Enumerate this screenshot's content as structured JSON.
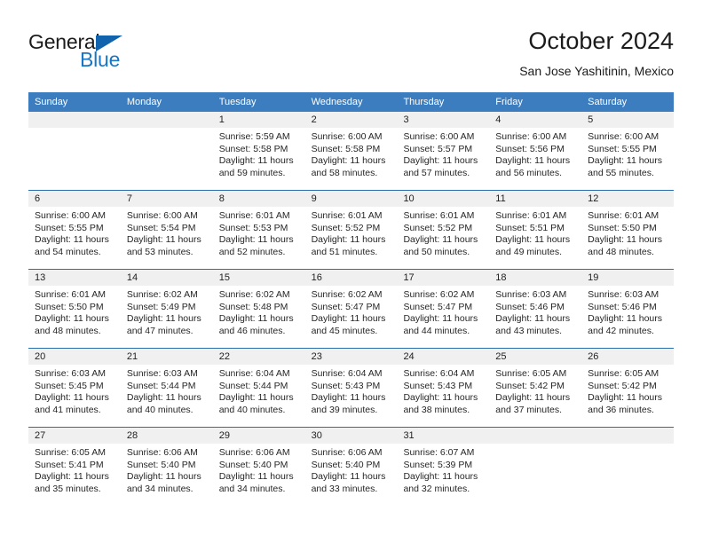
{
  "logo": {
    "word_top": "General",
    "word_bottom": "Blue",
    "triangle_icon": "triangle-icon",
    "brand_blue": "#1877c4",
    "brand_dark": "#1263ad"
  },
  "header": {
    "title": "October 2024",
    "location": "San Jose Yashitinin, Mexico"
  },
  "calendar": {
    "header_bg": "#3b7dbf",
    "daynum_bg": "#f0f0f0",
    "row_border": "#2f6ca8",
    "weekdays": [
      "Sunday",
      "Monday",
      "Tuesday",
      "Wednesday",
      "Thursday",
      "Friday",
      "Saturday"
    ],
    "weeks": [
      [
        {
          "day": "",
          "sunrise": "",
          "sunset": "",
          "daylight_1": "",
          "daylight_2": ""
        },
        {
          "day": "",
          "sunrise": "",
          "sunset": "",
          "daylight_1": "",
          "daylight_2": ""
        },
        {
          "day": "1",
          "sunrise": "Sunrise: 5:59 AM",
          "sunset": "Sunset: 5:58 PM",
          "daylight_1": "Daylight: 11 hours",
          "daylight_2": "and 59 minutes."
        },
        {
          "day": "2",
          "sunrise": "Sunrise: 6:00 AM",
          "sunset": "Sunset: 5:58 PM",
          "daylight_1": "Daylight: 11 hours",
          "daylight_2": "and 58 minutes."
        },
        {
          "day": "3",
          "sunrise": "Sunrise: 6:00 AM",
          "sunset": "Sunset: 5:57 PM",
          "daylight_1": "Daylight: 11 hours",
          "daylight_2": "and 57 minutes."
        },
        {
          "day": "4",
          "sunrise": "Sunrise: 6:00 AM",
          "sunset": "Sunset: 5:56 PM",
          "daylight_1": "Daylight: 11 hours",
          "daylight_2": "and 56 minutes."
        },
        {
          "day": "5",
          "sunrise": "Sunrise: 6:00 AM",
          "sunset": "Sunset: 5:55 PM",
          "daylight_1": "Daylight: 11 hours",
          "daylight_2": "and 55 minutes."
        }
      ],
      [
        {
          "day": "6",
          "sunrise": "Sunrise: 6:00 AM",
          "sunset": "Sunset: 5:55 PM",
          "daylight_1": "Daylight: 11 hours",
          "daylight_2": "and 54 minutes."
        },
        {
          "day": "7",
          "sunrise": "Sunrise: 6:00 AM",
          "sunset": "Sunset: 5:54 PM",
          "daylight_1": "Daylight: 11 hours",
          "daylight_2": "and 53 minutes."
        },
        {
          "day": "8",
          "sunrise": "Sunrise: 6:01 AM",
          "sunset": "Sunset: 5:53 PM",
          "daylight_1": "Daylight: 11 hours",
          "daylight_2": "and 52 minutes."
        },
        {
          "day": "9",
          "sunrise": "Sunrise: 6:01 AM",
          "sunset": "Sunset: 5:52 PM",
          "daylight_1": "Daylight: 11 hours",
          "daylight_2": "and 51 minutes."
        },
        {
          "day": "10",
          "sunrise": "Sunrise: 6:01 AM",
          "sunset": "Sunset: 5:52 PM",
          "daylight_1": "Daylight: 11 hours",
          "daylight_2": "and 50 minutes."
        },
        {
          "day": "11",
          "sunrise": "Sunrise: 6:01 AM",
          "sunset": "Sunset: 5:51 PM",
          "daylight_1": "Daylight: 11 hours",
          "daylight_2": "and 49 minutes."
        },
        {
          "day": "12",
          "sunrise": "Sunrise: 6:01 AM",
          "sunset": "Sunset: 5:50 PM",
          "daylight_1": "Daylight: 11 hours",
          "daylight_2": "and 48 minutes."
        }
      ],
      [
        {
          "day": "13",
          "sunrise": "Sunrise: 6:01 AM",
          "sunset": "Sunset: 5:50 PM",
          "daylight_1": "Daylight: 11 hours",
          "daylight_2": "and 48 minutes."
        },
        {
          "day": "14",
          "sunrise": "Sunrise: 6:02 AM",
          "sunset": "Sunset: 5:49 PM",
          "daylight_1": "Daylight: 11 hours",
          "daylight_2": "and 47 minutes."
        },
        {
          "day": "15",
          "sunrise": "Sunrise: 6:02 AM",
          "sunset": "Sunset: 5:48 PM",
          "daylight_1": "Daylight: 11 hours",
          "daylight_2": "and 46 minutes."
        },
        {
          "day": "16",
          "sunrise": "Sunrise: 6:02 AM",
          "sunset": "Sunset: 5:47 PM",
          "daylight_1": "Daylight: 11 hours",
          "daylight_2": "and 45 minutes."
        },
        {
          "day": "17",
          "sunrise": "Sunrise: 6:02 AM",
          "sunset": "Sunset: 5:47 PM",
          "daylight_1": "Daylight: 11 hours",
          "daylight_2": "and 44 minutes."
        },
        {
          "day": "18",
          "sunrise": "Sunrise: 6:03 AM",
          "sunset": "Sunset: 5:46 PM",
          "daylight_1": "Daylight: 11 hours",
          "daylight_2": "and 43 minutes."
        },
        {
          "day": "19",
          "sunrise": "Sunrise: 6:03 AM",
          "sunset": "Sunset: 5:46 PM",
          "daylight_1": "Daylight: 11 hours",
          "daylight_2": "and 42 minutes."
        }
      ],
      [
        {
          "day": "20",
          "sunrise": "Sunrise: 6:03 AM",
          "sunset": "Sunset: 5:45 PM",
          "daylight_1": "Daylight: 11 hours",
          "daylight_2": "and 41 minutes."
        },
        {
          "day": "21",
          "sunrise": "Sunrise: 6:03 AM",
          "sunset": "Sunset: 5:44 PM",
          "daylight_1": "Daylight: 11 hours",
          "daylight_2": "and 40 minutes."
        },
        {
          "day": "22",
          "sunrise": "Sunrise: 6:04 AM",
          "sunset": "Sunset: 5:44 PM",
          "daylight_1": "Daylight: 11 hours",
          "daylight_2": "and 40 minutes."
        },
        {
          "day": "23",
          "sunrise": "Sunrise: 6:04 AM",
          "sunset": "Sunset: 5:43 PM",
          "daylight_1": "Daylight: 11 hours",
          "daylight_2": "and 39 minutes."
        },
        {
          "day": "24",
          "sunrise": "Sunrise: 6:04 AM",
          "sunset": "Sunset: 5:43 PM",
          "daylight_1": "Daylight: 11 hours",
          "daylight_2": "and 38 minutes."
        },
        {
          "day": "25",
          "sunrise": "Sunrise: 6:05 AM",
          "sunset": "Sunset: 5:42 PM",
          "daylight_1": "Daylight: 11 hours",
          "daylight_2": "and 37 minutes."
        },
        {
          "day": "26",
          "sunrise": "Sunrise: 6:05 AM",
          "sunset": "Sunset: 5:42 PM",
          "daylight_1": "Daylight: 11 hours",
          "daylight_2": "and 36 minutes."
        }
      ],
      [
        {
          "day": "27",
          "sunrise": "Sunrise: 6:05 AM",
          "sunset": "Sunset: 5:41 PM",
          "daylight_1": "Daylight: 11 hours",
          "daylight_2": "and 35 minutes."
        },
        {
          "day": "28",
          "sunrise": "Sunrise: 6:06 AM",
          "sunset": "Sunset: 5:40 PM",
          "daylight_1": "Daylight: 11 hours",
          "daylight_2": "and 34 minutes."
        },
        {
          "day": "29",
          "sunrise": "Sunrise: 6:06 AM",
          "sunset": "Sunset: 5:40 PM",
          "daylight_1": "Daylight: 11 hours",
          "daylight_2": "and 34 minutes."
        },
        {
          "day": "30",
          "sunrise": "Sunrise: 6:06 AM",
          "sunset": "Sunset: 5:40 PM",
          "daylight_1": "Daylight: 11 hours",
          "daylight_2": "and 33 minutes."
        },
        {
          "day": "31",
          "sunrise": "Sunrise: 6:07 AM",
          "sunset": "Sunset: 5:39 PM",
          "daylight_1": "Daylight: 11 hours",
          "daylight_2": "and 32 minutes."
        },
        {
          "day": "",
          "sunrise": "",
          "sunset": "",
          "daylight_1": "",
          "daylight_2": ""
        },
        {
          "day": "",
          "sunrise": "",
          "sunset": "",
          "daylight_1": "",
          "daylight_2": ""
        }
      ]
    ]
  }
}
